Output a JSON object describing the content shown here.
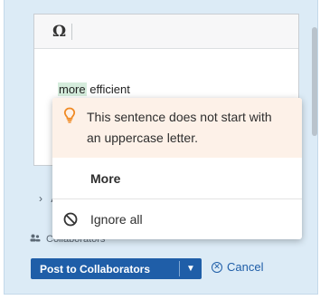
{
  "editor": {
    "toolbar_symbol": "Ω",
    "text_highlighted": "more",
    "text_rest": " efficient"
  },
  "accordion": {
    "chevron": "›",
    "label_visible": "A"
  },
  "collaborators": {
    "icon": "people-icon",
    "label": "Collaborators"
  },
  "actions": {
    "post_label": "Post to Collaborators",
    "post_caret": "▼",
    "cancel_label": "Cancel"
  },
  "popup": {
    "message": "This sentence does not start with an uppercase letter.",
    "more_label": "More",
    "ignore_label": "Ignore all"
  },
  "colors": {
    "panel_bg": "#dcebf6",
    "accent": "#1f5ea8",
    "warning": "#f08a24",
    "highlight": "#d5ecdc"
  }
}
